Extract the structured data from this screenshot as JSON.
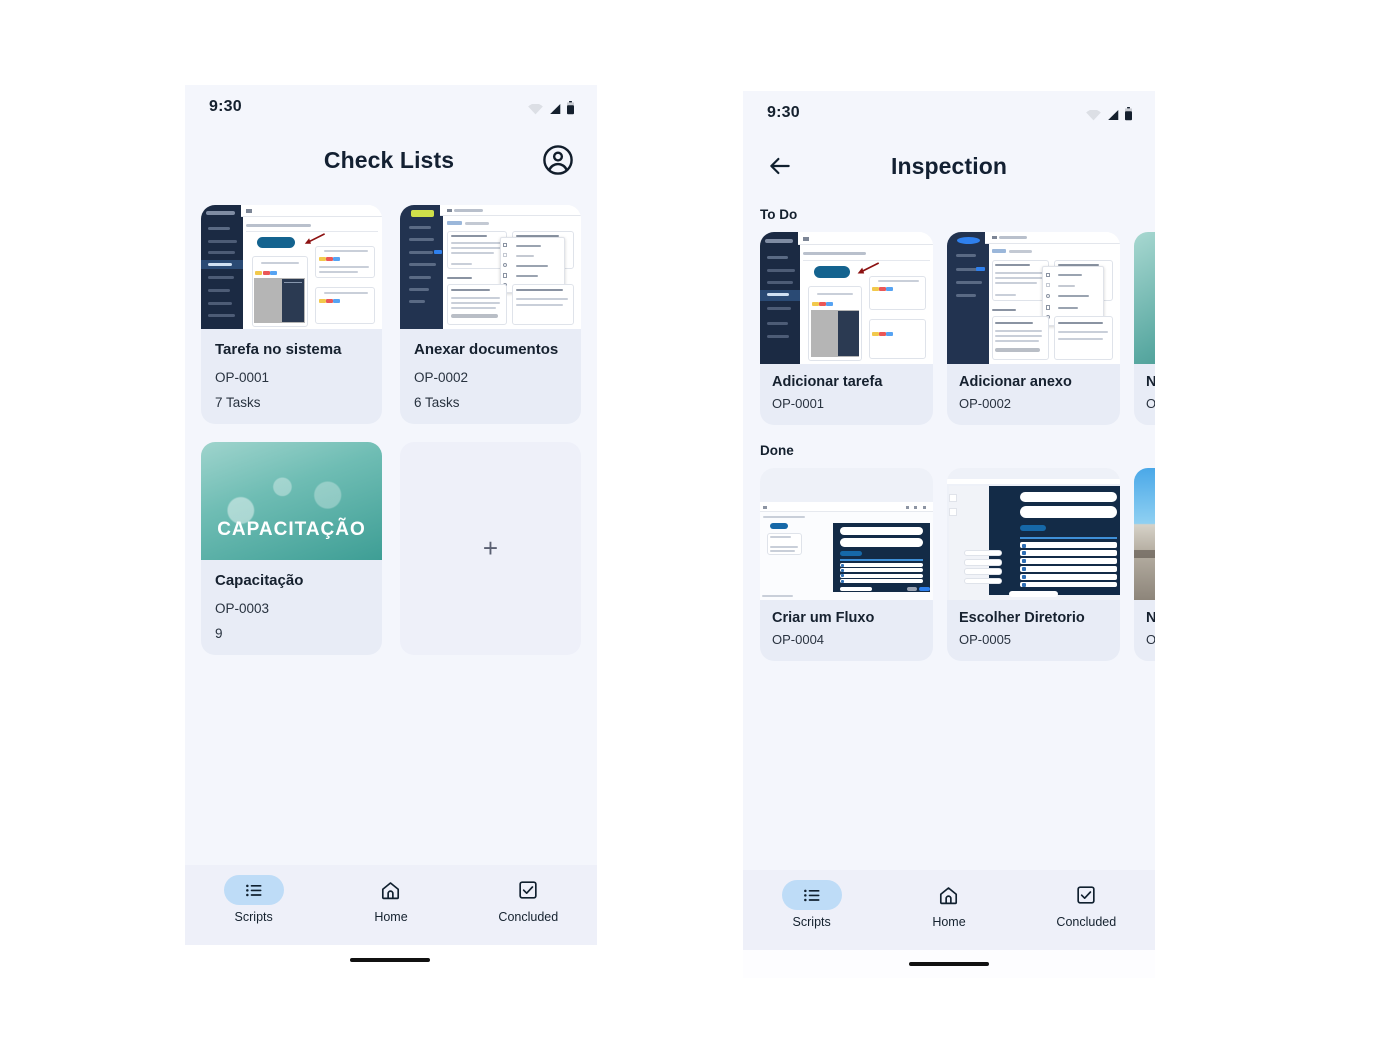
{
  "screens": {
    "left": {
      "status": {
        "time": "9:30",
        "wifi_icon": "wifi-icon",
        "signal_icon": "signal-icon",
        "battery_icon": "battery-icon"
      },
      "appbar": {
        "title": "Check Lists",
        "avatar_icon": "account-circle-icon"
      },
      "cards": [
        {
          "title": "Tarefa no sistema",
          "code": "OP-0001",
          "count": "7 Tasks",
          "thumb": "mock-task-board"
        },
        {
          "title": "Anexar documentos",
          "code": "OP-0002",
          "count": "6 Tasks",
          "thumb": "mock-menu-board"
        },
        {
          "title": "Capacitação",
          "code": "OP-0003",
          "count": "9",
          "thumb": "photo-capacitacao",
          "photo_caption": "CAPACITAÇÃO"
        }
      ],
      "add_card": {
        "icon": "plus-icon",
        "label": "+"
      },
      "nav": {
        "items": [
          {
            "label": "Scripts",
            "icon": "list-icon",
            "active": true
          },
          {
            "label": "Home",
            "icon": "home-icon",
            "active": false
          },
          {
            "label": "Concluded",
            "icon": "check-box-icon",
            "active": false
          }
        ],
        "active_pill_color": "#bedcf7"
      }
    },
    "right": {
      "status": {
        "time": "9:30",
        "wifi_icon": "wifi-icon",
        "signal_icon": "signal-icon",
        "battery_icon": "battery-icon"
      },
      "appbar": {
        "title": "Inspection",
        "back_icon": "arrow-back-icon"
      },
      "sections": [
        {
          "label": "To Do",
          "cards": [
            {
              "title": "Adicionar tarefa",
              "code": "OP-0001",
              "thumb": "mock-task-board"
            },
            {
              "title": "Adicionar anexo",
              "code": "OP-0002",
              "thumb": "mock-menu-board"
            },
            {
              "title": "N",
              "code": "O",
              "thumb": "photo-teal-clipped"
            }
          ]
        },
        {
          "label": "Done",
          "cards": [
            {
              "title": "Criar um Fluxo",
              "code": "OP-0004",
              "thumb": "mock-flow-board"
            },
            {
              "title": "Escolher Diretorio",
              "code": "OP-0005",
              "thumb": "mock-directory-board"
            },
            {
              "title": "N",
              "code": "O",
              "thumb": "photo-sky-clipped"
            }
          ]
        }
      ],
      "nav": {
        "items": [
          {
            "label": "Scripts",
            "icon": "list-icon",
            "active": true
          },
          {
            "label": "Home",
            "icon": "home-icon",
            "active": false
          },
          {
            "label": "Concluded",
            "icon": "check-box-icon",
            "active": false
          }
        ],
        "active_pill_color": "#bedcf7"
      }
    }
  },
  "theme": {
    "page_bg": "#ffffff",
    "screen_bg": "#f4f6fc",
    "card_bg": "#e8ecf6",
    "nav_bg": "#eef0f9",
    "text_primary": "#16212f",
    "accent": "#bedcf7"
  }
}
